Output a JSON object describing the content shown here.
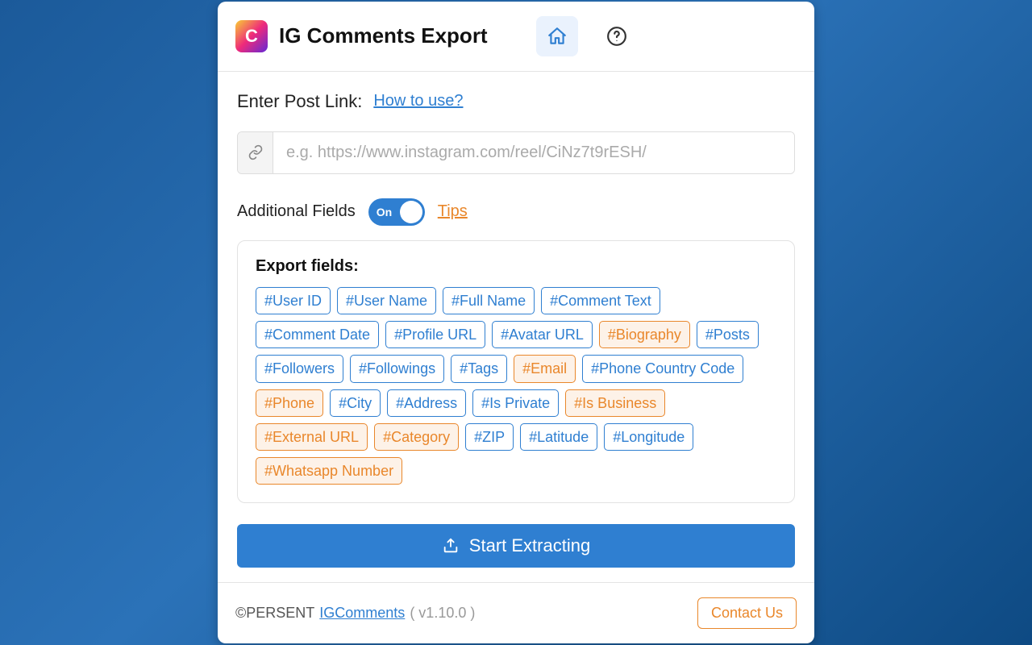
{
  "header": {
    "logo_letter": "C",
    "title": "IG Comments Export"
  },
  "post": {
    "label": "Enter Post Link:",
    "how_link": "How to use?",
    "placeholder": "e.g. https://www.instagram.com/reel/CiNz7t9rESH/",
    "value": ""
  },
  "fields": {
    "label": "Additional Fields",
    "toggle_state": "On",
    "tips": "Tips",
    "box_title": "Export fields:",
    "tags": [
      {
        "label": "#User ID",
        "variant": "blue"
      },
      {
        "label": "#User Name",
        "variant": "blue"
      },
      {
        "label": "#Full Name",
        "variant": "blue"
      },
      {
        "label": "#Comment Text",
        "variant": "blue"
      },
      {
        "label": "#Comment Date",
        "variant": "blue"
      },
      {
        "label": "#Profile URL",
        "variant": "blue"
      },
      {
        "label": "#Avatar URL",
        "variant": "blue"
      },
      {
        "label": "#Biography",
        "variant": "orange"
      },
      {
        "label": "#Posts",
        "variant": "blue"
      },
      {
        "label": "#Followers",
        "variant": "blue"
      },
      {
        "label": "#Followings",
        "variant": "blue"
      },
      {
        "label": "#Tags",
        "variant": "blue"
      },
      {
        "label": "#Email",
        "variant": "orange"
      },
      {
        "label": "#Phone Country Code",
        "variant": "blue"
      },
      {
        "label": "#Phone",
        "variant": "orange"
      },
      {
        "label": "#City",
        "variant": "blue"
      },
      {
        "label": "#Address",
        "variant": "blue"
      },
      {
        "label": "#Is Private",
        "variant": "blue"
      },
      {
        "label": "#Is Business",
        "variant": "orange"
      },
      {
        "label": "#External URL",
        "variant": "orange"
      },
      {
        "label": "#Category",
        "variant": "orange"
      },
      {
        "label": "#ZIP",
        "variant": "blue"
      },
      {
        "label": "#Latitude",
        "variant": "blue"
      },
      {
        "label": "#Longitude",
        "variant": "blue"
      },
      {
        "label": "#Whatsapp Number",
        "variant": "orange"
      }
    ]
  },
  "action": {
    "extract_label": "Start Extracting"
  },
  "footer": {
    "copyright": "©PERSENT",
    "brand_link": "IGComments",
    "version": "( v1.10.0 )",
    "contact": "Contact Us"
  }
}
